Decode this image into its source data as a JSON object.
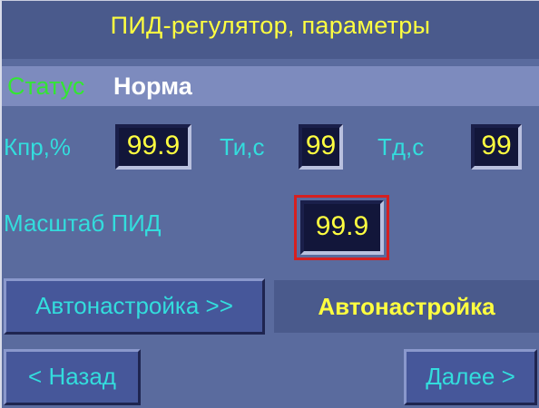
{
  "window": {
    "title": "ПИД-регулятор, параметры"
  },
  "status": {
    "label": "Статус",
    "value": "Норма"
  },
  "params": {
    "kp_label": "Кпр,%",
    "kp_value": "99.9",
    "ti_label": "Ти,с",
    "ti_value": "99",
    "td_label": "Тд,с",
    "td_value": "99",
    "scale_label": "Масштаб ПИД",
    "scale_value": "99.9"
  },
  "autotune": {
    "button_label": "Автонастройка >>",
    "state_text": "Автонастройка"
  },
  "navigation": {
    "back_label": "< Назад",
    "next_label": "Далее >"
  },
  "colors": {
    "background": "#5a6b9e",
    "title_text": "#ffff40",
    "label_text": "#33dddd",
    "status_label": "#33e633",
    "value_text": "#ffff40",
    "value_background": "#12163a",
    "selection_frame": "#d62020"
  }
}
